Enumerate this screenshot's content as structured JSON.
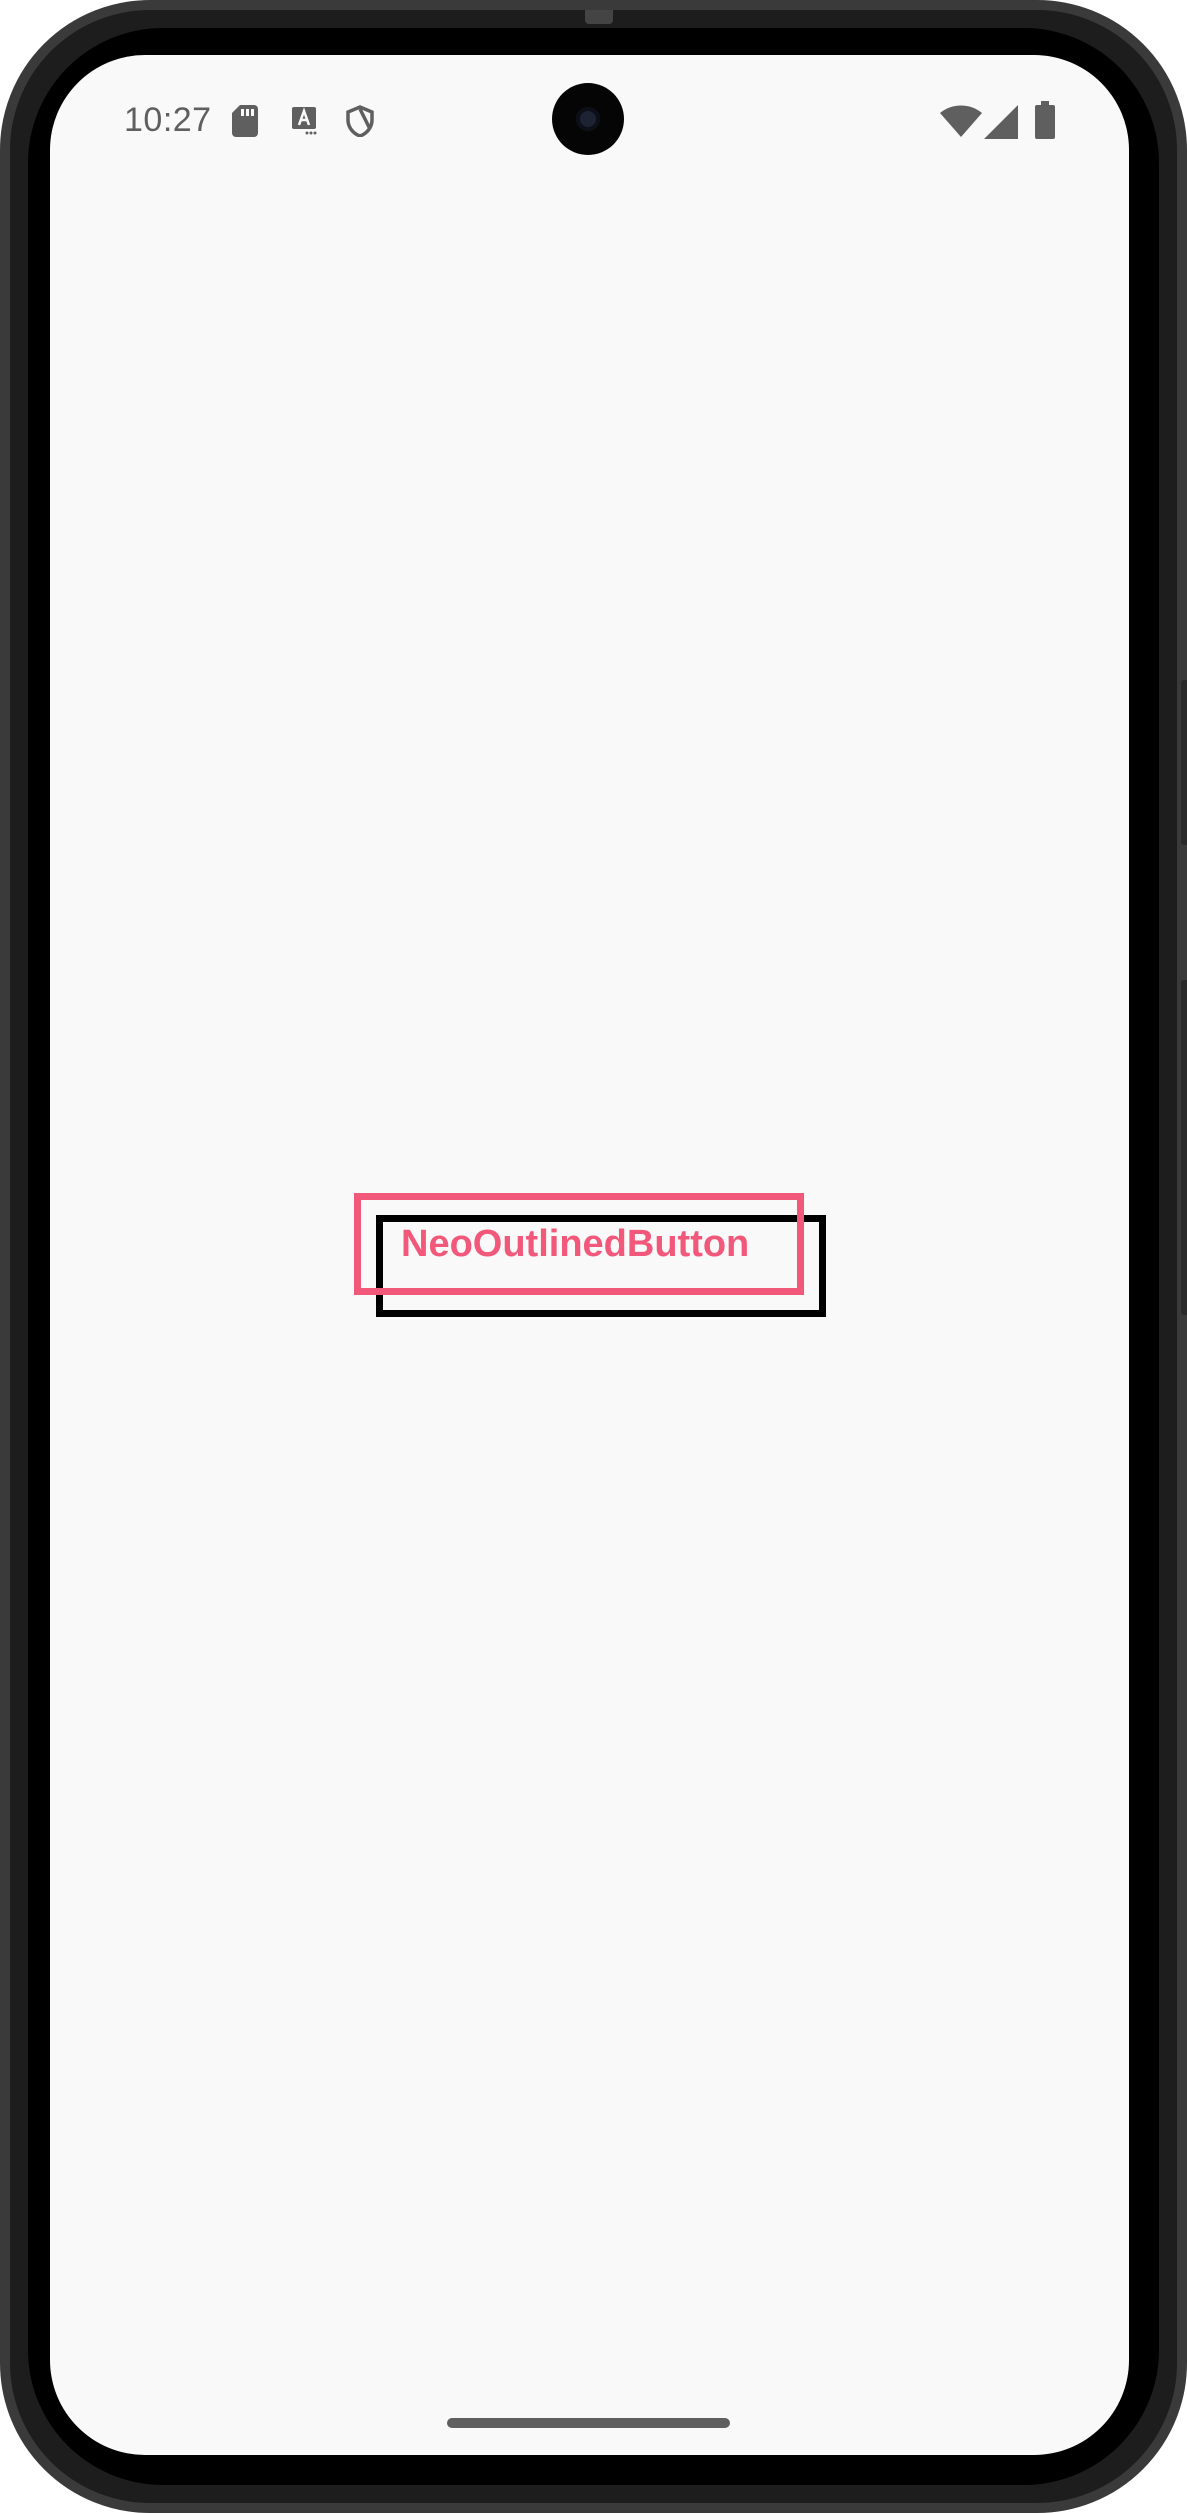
{
  "status_bar": {
    "time": "10:27",
    "left_icons": [
      "sd-card-icon",
      "text-a-icon",
      "shield-icon"
    ],
    "right_icons": [
      "wifi-icon",
      "cell-signal-icon",
      "battery-icon"
    ]
  },
  "main": {
    "button_label": "NeoOutlinedButton"
  },
  "colors": {
    "accent": "#f2587a",
    "shadow": "#000000",
    "background": "#f9f9f9",
    "status_icons": "#5f5f5f"
  }
}
